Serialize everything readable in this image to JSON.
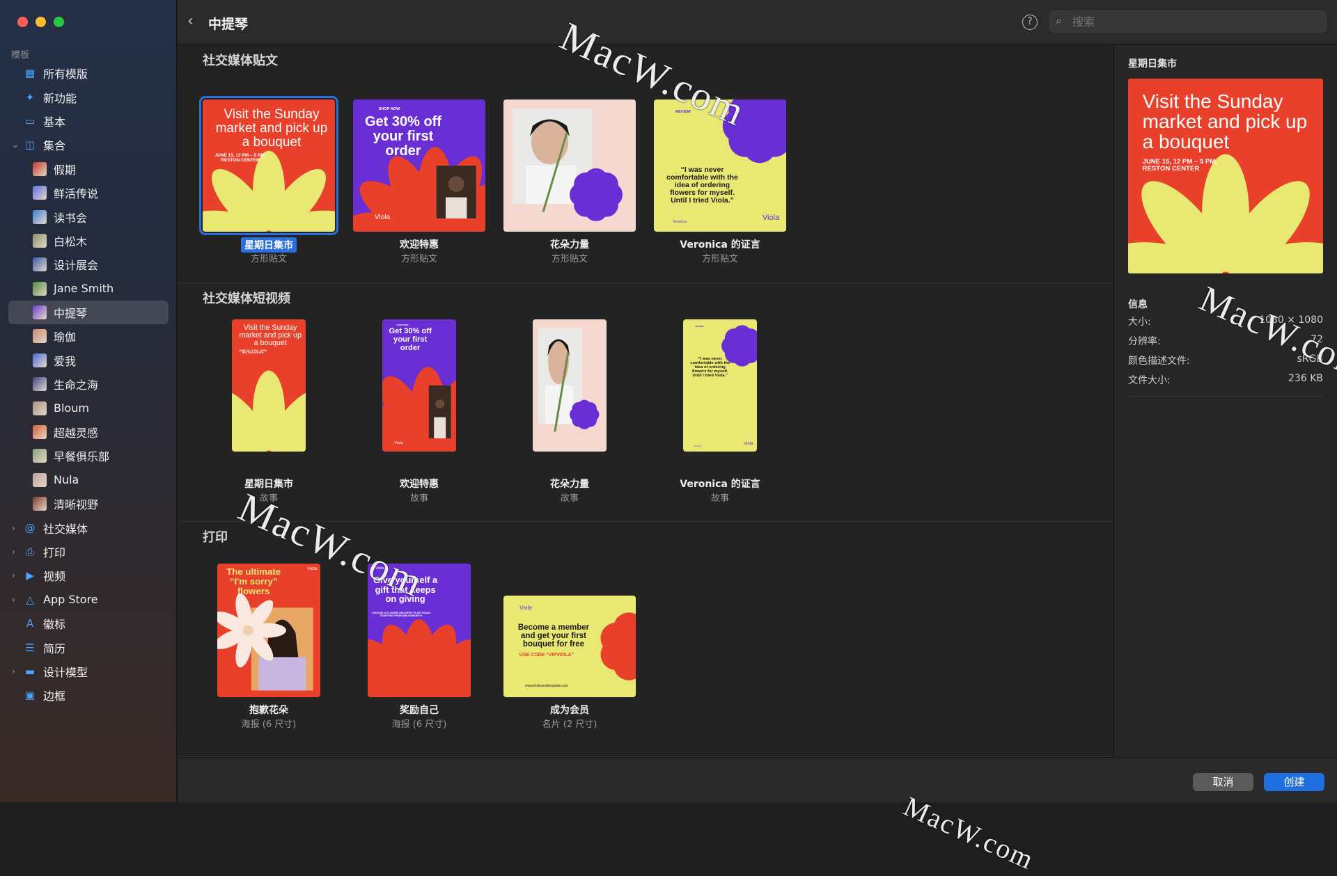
{
  "window": {
    "traffic_lights": [
      "#ff5f57",
      "#febc2e",
      "#28c840"
    ]
  },
  "sidebar": {
    "header": "模板",
    "items": [
      {
        "label": "所有模版",
        "icon": "grid-icon",
        "level": 0,
        "expandable": false,
        "selected": false,
        "thumb": null
      },
      {
        "label": "新功能",
        "icon": "sparkle-icon",
        "level": 0,
        "expandable": false,
        "selected": false,
        "thumb": null
      },
      {
        "label": "基本",
        "icon": "rectangle-icon",
        "level": 0,
        "expandable": false,
        "selected": false,
        "thumb": null
      },
      {
        "label": "集合",
        "icon": "collection-icon",
        "level": 0,
        "expandable": true,
        "expanded": true,
        "selected": false,
        "thumb": null
      },
      {
        "label": "假期",
        "level": 1,
        "thumb": "#c0392b",
        "selected": false
      },
      {
        "label": "鲜活传说",
        "level": 1,
        "thumb": "#5b6ee8",
        "selected": false
      },
      {
        "label": "读书会",
        "level": 1,
        "thumb": "#3e7fd8",
        "selected": false
      },
      {
        "label": "白松木",
        "level": 1,
        "thumb": "#8c8f6a",
        "selected": false
      },
      {
        "label": "设计展会",
        "level": 1,
        "thumb": "#3a5ba8",
        "selected": false
      },
      {
        "label": "Jane Smith",
        "level": 1,
        "thumb": "#4c8a3a",
        "selected": false
      },
      {
        "label": "中提琴",
        "level": 1,
        "thumb": "#6a3ed0",
        "selected": true
      },
      {
        "label": "瑜伽",
        "level": 1,
        "thumb": "#c98a6a",
        "selected": false
      },
      {
        "label": "爱我",
        "level": 1,
        "thumb": "#4a6ae0",
        "selected": false
      },
      {
        "label": "生命之海",
        "level": 1,
        "thumb": "#3a4a8a",
        "selected": false
      },
      {
        "label": "Bloum",
        "level": 1,
        "thumb": "#a89080",
        "selected": false
      },
      {
        "label": "超越灵感",
        "level": 1,
        "thumb": "#d06030",
        "selected": false
      },
      {
        "label": "早餐俱乐部",
        "level": 1,
        "thumb": "#8aa07a",
        "selected": false
      },
      {
        "label": "Nula",
        "level": 1,
        "thumb": "#c0a0a0",
        "selected": false
      },
      {
        "label": "清晰视野",
        "level": 1,
        "thumb": "#7a3a2a",
        "selected": false
      },
      {
        "label": "社交媒体",
        "icon": "at-icon",
        "level": 0,
        "expandable": true,
        "expanded": false,
        "selected": false,
        "thumb": null
      },
      {
        "label": "打印",
        "icon": "printer-icon",
        "level": 0,
        "expandable": true,
        "expanded": false,
        "selected": false,
        "thumb": null
      },
      {
        "label": "视频",
        "icon": "play-icon",
        "level": 0,
        "expandable": true,
        "expanded": false,
        "selected": false,
        "thumb": null
      },
      {
        "label": "App Store",
        "icon": "appstore-icon",
        "level": 0,
        "expandable": true,
        "expanded": false,
        "selected": false,
        "thumb": null
      },
      {
        "label": "徽标",
        "icon": "letter-a-icon",
        "level": 0,
        "expandable": false,
        "selected": false,
        "thumb": null
      },
      {
        "label": "简历",
        "icon": "document-icon",
        "level": 0,
        "expandable": false,
        "selected": false,
        "thumb": null
      },
      {
        "label": "设计模型",
        "icon": "display-icon",
        "level": 0,
        "expandable": true,
        "expanded": false,
        "selected": false,
        "thumb": null
      },
      {
        "label": "边框",
        "icon": "frame-icon",
        "level": 0,
        "expandable": false,
        "selected": false,
        "thumb": null
      }
    ]
  },
  "toolbar": {
    "title": "中提琴",
    "search_placeholder": "搜索"
  },
  "sections": [
    {
      "title": "社交媒体贴文",
      "cards": [
        {
          "name": "星期日集市",
          "sub": "方形贴文",
          "selected": true
        },
        {
          "name": "欢迎特惠",
          "sub": "方形贴文"
        },
        {
          "name": "花朵力量",
          "sub": "方形贴文"
        },
        {
          "name": "Veronica 的证言",
          "sub": "方形贴文"
        }
      ]
    },
    {
      "title": "社交媒体短视频",
      "cards": [
        {
          "name": "星期日集市",
          "sub": "故事"
        },
        {
          "name": "欢迎特惠",
          "sub": "故事"
        },
        {
          "name": "花朵力量",
          "sub": "故事"
        },
        {
          "name": "Veronica 的证言",
          "sub": "故事"
        }
      ]
    },
    {
      "title": "打印",
      "cards": [
        {
          "name": "抱歉花朵",
          "sub": "海报 (6 尺寸)"
        },
        {
          "name": "奖励自己",
          "sub": "海报 (6 尺寸)"
        },
        {
          "name": "成为会员",
          "sub": "名片 (2 尺寸)"
        }
      ]
    }
  ],
  "template_text": {
    "sunday_headline": "Visit the Sunday market and pick up a bouquet",
    "sunday_detail": "JUNE 15, 12 PM – 5 PM, RESTON CENTER",
    "offer_kicker": "SHOP NOW",
    "offer_headline": "Get 30% off your first order",
    "brand": "Viola",
    "review_kicker": "REVIEW",
    "review_quote": "“I was never comfortable with the idea of ordering flowers for myself. Until I tried Viola.”",
    "review_author": "Veronica",
    "sorry_headline": "The ultimate “I'm sorry” flowers",
    "gift_headline": "Give yourself a gift that keeps on giving",
    "gift_detail": "CHOOSE A FLOWER DELIVERY PLAN TODAY, STARTING FROM $49.00/MONTH.",
    "member_headline": "Become a member and get your first bouquet for free",
    "member_code": "USE CODE “VIPVIOLA”",
    "member_url": "www.thebrandtemplate.com"
  },
  "panel": {
    "title": "星期日集市",
    "info_header": "信息",
    "rows": [
      {
        "label": "大小:",
        "value": "1080 × 1080"
      },
      {
        "label": "分辨率:",
        "value": "72"
      },
      {
        "label": "颜色描述文件:",
        "value": "sRGB"
      },
      {
        "label": "文件大小:",
        "value": "236 KB"
      }
    ]
  },
  "buttons": {
    "cancel": "取消",
    "create": "创建"
  },
  "watermark": "MacW.com",
  "colors": {
    "red": "#e8402a",
    "purple": "#6a2fd4",
    "yellow": "#e9e873",
    "pink": "#f5d9d0",
    "accent": "#2a6fe0"
  }
}
